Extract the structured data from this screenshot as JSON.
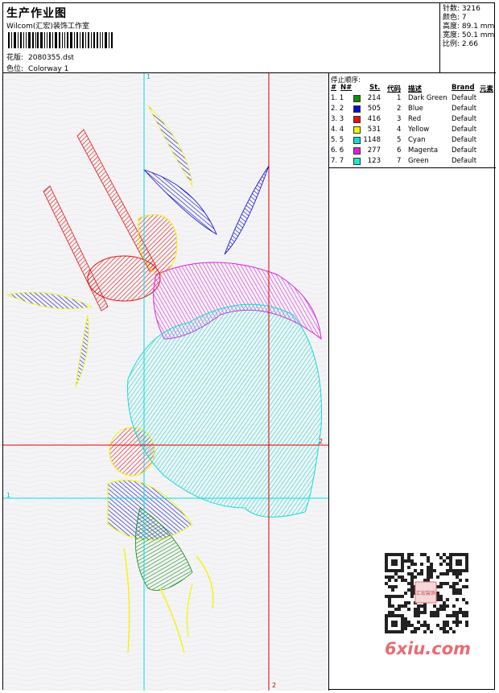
{
  "header": {
    "title": "生产作业图",
    "company": "Wilcom(汇宏)装饰工作室",
    "design_label": "花版:",
    "design_value": "2080355.dst",
    "colorway_label": "色位:",
    "colorway_value": "Colorway 1"
  },
  "stats": {
    "stitches": "针数: 3216",
    "colors": "颜色: 7",
    "height": "高度: 89.1 mm",
    "width": "宽度: 50.1 mm",
    "scale": "比例: 2.66"
  },
  "stop_sequence": {
    "title": "停止顺序:",
    "headers": [
      "#",
      "N#",
      "St.",
      "代码",
      "描述",
      "Brand",
      "元素"
    ],
    "rows": [
      {
        "num": "1. 1",
        "color": "#108a10",
        "stitches": "214",
        "code": "1",
        "desc": "Dark Green",
        "brand": "Default"
      },
      {
        "num": "2. 2",
        "color": "#0a0ad8",
        "stitches": "505",
        "code": "2",
        "desc": "Blue",
        "brand": "Default"
      },
      {
        "num": "3. 3",
        "color": "#e41414",
        "stitches": "416",
        "code": "3",
        "desc": "Red",
        "brand": "Default"
      },
      {
        "num": "4. 4",
        "color": "#f4f400",
        "stitches": "531",
        "code": "4",
        "desc": "Yellow",
        "brand": "Default"
      },
      {
        "num": "5. 5",
        "color": "#14dcd2",
        "stitches": "1148",
        "code": "5",
        "desc": "Cyan",
        "brand": "Default"
      },
      {
        "num": "6. 6",
        "color": "#e020e0",
        "stitches": "277",
        "code": "6",
        "desc": "Magenta",
        "brand": "Default"
      },
      {
        "num": "7. 7",
        "color": "#20e8c8",
        "stitches": "123",
        "code": "7",
        "desc": "Green",
        "brand": "Default"
      }
    ]
  },
  "markers": {
    "cyan_v": "1",
    "cyan_h": "1",
    "red_v": "2",
    "red_h": "2"
  },
  "watermark": {
    "qr_center": "汇宏装饰",
    "site": "6xiu.com"
  },
  "colors": {
    "cyan_line": "#00e0e8",
    "red_line": "#e00000"
  }
}
